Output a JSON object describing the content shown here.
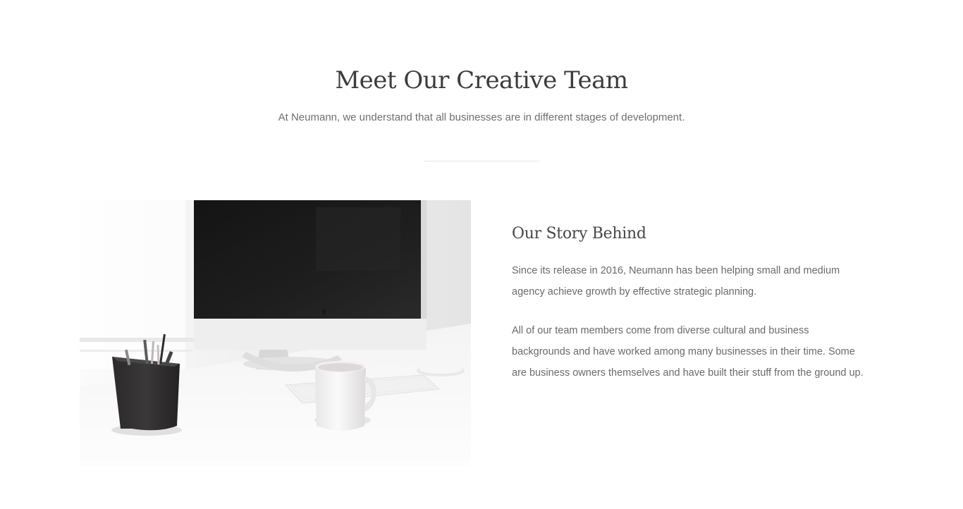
{
  "header": {
    "title": "Meet Our Creative Team",
    "subtitle": "At Neumann, we understand that all businesses are in different stages of development."
  },
  "story": {
    "heading": "Our Story Behind",
    "paragraphs": [
      "Since its release in 2016, Neumann has been helping small and medium agency achieve growth by effective strategic planning.",
      "All of our team members come from diverse cultural and business backgrounds and have worked among many businesses in their time. Some are business owners themselves and have built their stuff from the ground up."
    ]
  },
  "image": {
    "subject": "workspace-desk-with-computer"
  }
}
